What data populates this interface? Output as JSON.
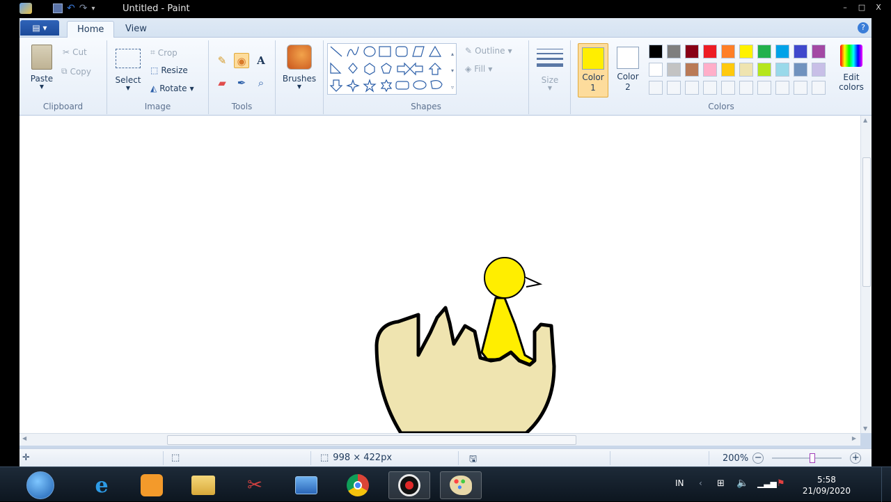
{
  "window": {
    "title": "Untitled - Paint",
    "controls": {
      "minimize": "–",
      "maximize": "□",
      "close": "X"
    }
  },
  "ribbon_tabs": {
    "home": "Home",
    "view": "View"
  },
  "clipboard": {
    "paste": "Paste",
    "cut": "Cut",
    "copy": "Copy",
    "label": "Clipboard"
  },
  "image": {
    "select": "Select",
    "crop": "Crop",
    "resize": "Resize",
    "rotate": "Rotate",
    "label": "Image"
  },
  "tools": {
    "label": "Tools",
    "text_glyph": "A"
  },
  "brushes": {
    "label": "Brushes"
  },
  "shapes": {
    "outline": "Outline",
    "fill": "Fill",
    "label": "Shapes"
  },
  "size": {
    "label": "Size"
  },
  "colors": {
    "color1_label": "Color",
    "color1_num": "1",
    "color2_label": "Color",
    "color2_num": "2",
    "color1_value": "#ffee00",
    "color2_value": "#ffffff",
    "edit": "Edit",
    "edit2": "colors",
    "label": "Colors",
    "palette_row1": [
      "#000000",
      "#7f7f7f",
      "#880015",
      "#ed1c24",
      "#ff7f27",
      "#fff200",
      "#22b14c",
      "#00a2e8",
      "#3f48cc",
      "#a349a4"
    ],
    "palette_row2": [
      "#ffffff",
      "#c3c3c3",
      "#b97a57",
      "#ffaec9",
      "#ffc90e",
      "#efe4b0",
      "#b5e61d",
      "#99d9ea",
      "#7092be",
      "#c8bfe7"
    ]
  },
  "statusbar": {
    "dimensions": "998 × 422px",
    "zoom": "200%"
  },
  "taskbar": {
    "lang": "IN",
    "time": "5:58",
    "date": "21/09/2020"
  },
  "drawing": {
    "head_color": "#ffee00",
    "shell_color": "#efe4b0",
    "outline_color": "#000000"
  }
}
